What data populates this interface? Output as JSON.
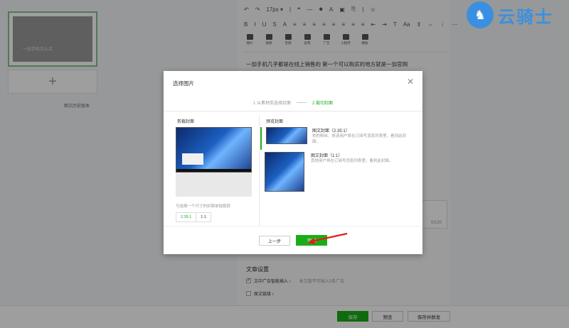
{
  "left_panel": {
    "thumb_caption": "一加手机怎么买",
    "add_symbol": "+",
    "history_link": "图文历史版本"
  },
  "toolbar": {
    "row1": [
      "↶",
      "↷",
      "17px ▾",
      "|",
      "❝",
      "—",
      "⬥",
      "A",
      "▣",
      "⎘",
      "|",
      "☺"
    ],
    "row2": [
      "B",
      "I",
      "U",
      "S",
      "A",
      "≡",
      "≡",
      "≡",
      "≡",
      "≡",
      "≡",
      "≡",
      "≡",
      "⇤",
      "⇥",
      "T",
      "Aa",
      "⇕",
      "⇔",
      "⋮",
      "⋯"
    ],
    "media": [
      "图片",
      "视频",
      "音频",
      "投票",
      "广告",
      "小程序",
      "模板"
    ]
  },
  "article_text": "一加手机几乎都是在线上销售的 第一个可以购买的地方就是一加官网",
  "digest_count": "0/120",
  "settings": {
    "title": "文章设置",
    "ad_insert": "文中广告智能插入 ›",
    "ad_hint": "本文暂不可插入0条广告",
    "orig_link": "原文链接 ›"
  },
  "bottom_bar": {
    "save": "保存",
    "preview": "预览",
    "publish": "保存并群发"
  },
  "logo": {
    "text": "云骑士",
    "badge": "♞"
  },
  "modal": {
    "title": "选择图片",
    "close": "✕",
    "step1": "1 从素材库选择封面",
    "step2": "2 裁切封面",
    "crop_label": "剪裁封面",
    "preview_label": "预览封面",
    "hint": "可选择一个尺寸的封面单独裁剪",
    "ratio_options": [
      "2.35:1",
      "1:1"
    ],
    "preview_items": [
      {
        "title": "图文封面（2.35:1）",
        "desc": "你的粉丝、将该用户将在订阅号消息列表里，看到此封面。"
      },
      {
        "title": "图文封面（1:1）",
        "desc": "其他用户将在订阅号消息列表里，看到此封面。"
      }
    ],
    "btn_prev": "上一步",
    "btn_done": "完成"
  },
  "colors": {
    "accent_green": "#1aad19",
    "overlay": "rgba(0,0,0,0.38)",
    "logo_blue": "#3a8fe0"
  }
}
